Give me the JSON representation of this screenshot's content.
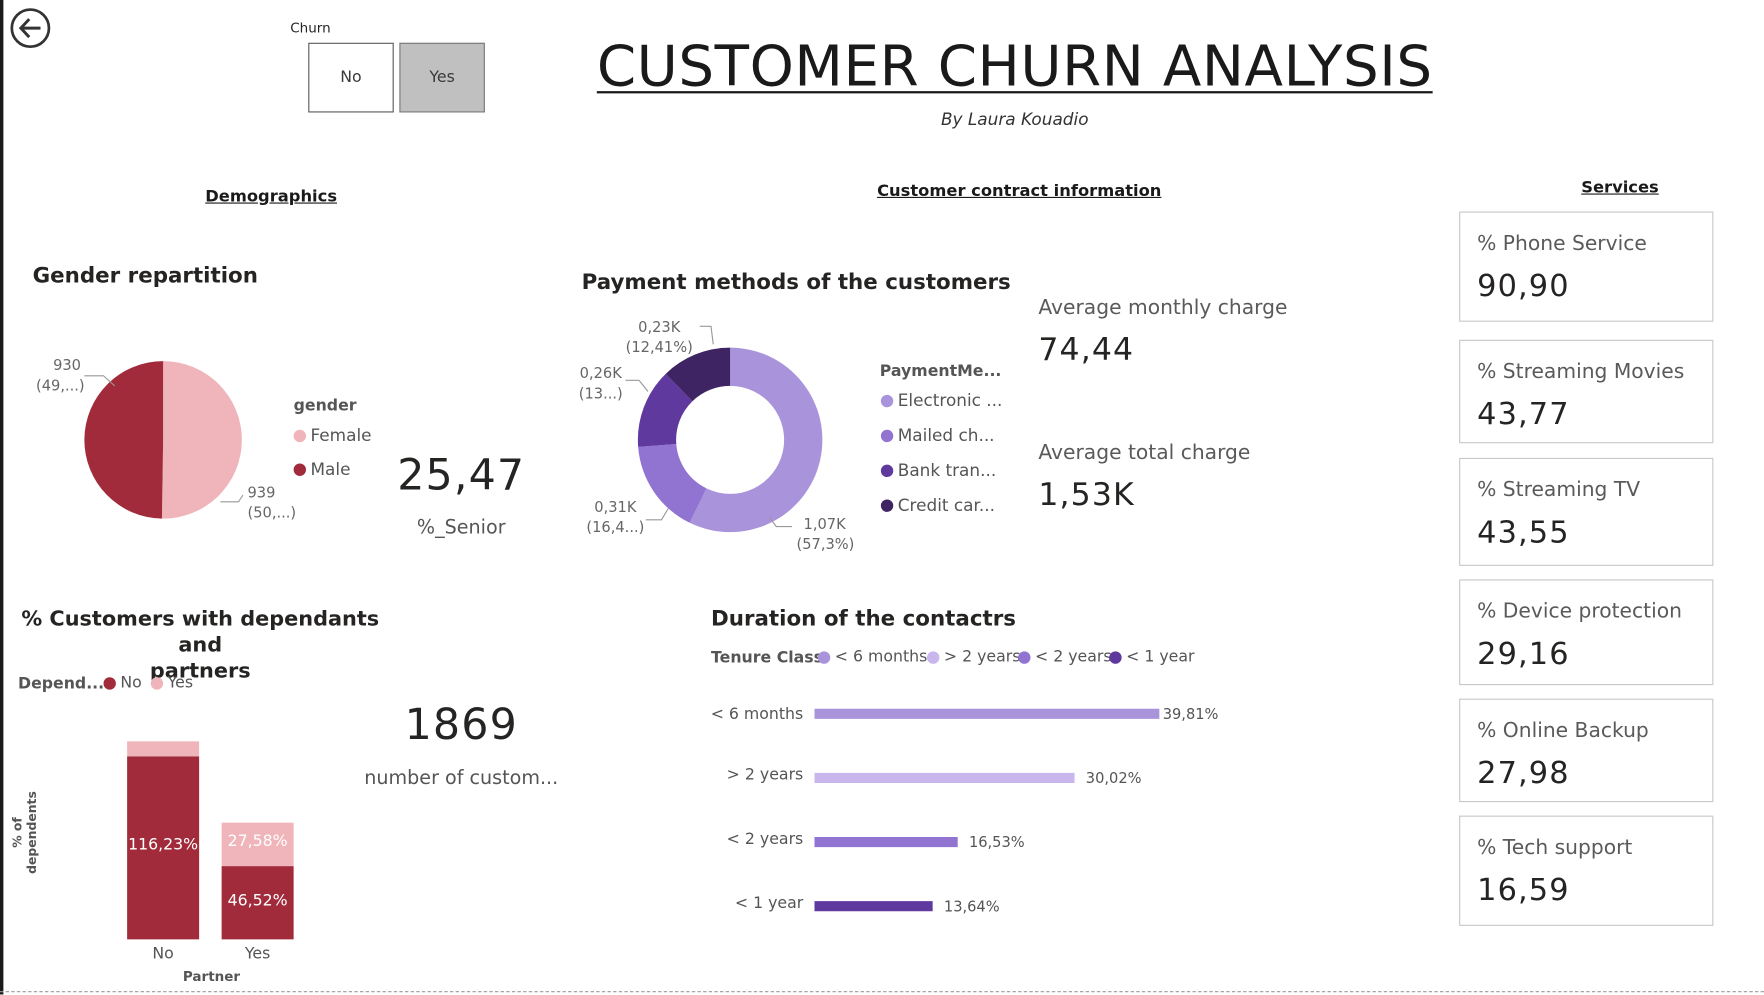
{
  "header": {
    "title": "CUSTOMER CHURN ANALYSIS",
    "subtitle": "By Laura Kouadio"
  },
  "back_button": {
    "icon": "arrow-left-circle-icon"
  },
  "churn_slicer": {
    "title": "Churn",
    "options": [
      "No",
      "Yes"
    ],
    "selected": "Yes"
  },
  "sections": {
    "demographics": "Demographics",
    "contract": "Customer contract information",
    "services": "Services"
  },
  "gender_chart": {
    "title": "Gender repartition",
    "legend_title": "gender",
    "legend": [
      "Female",
      "Male"
    ],
    "label_male": [
      "930",
      "(49,...)"
    ],
    "label_female": [
      "939",
      "(50,...)"
    ]
  },
  "senior_kpi": {
    "value": "25,47",
    "label": "%_Senior"
  },
  "payment_chart": {
    "title": "Payment methods of the customers",
    "legend_title": "PaymentMe...",
    "legend": [
      "Electronic ...",
      "Mailed ch...",
      "Bank tran...",
      "Credit car..."
    ],
    "labels": {
      "electronic": [
        "1,07K",
        "(57,3%)"
      ],
      "mailed": [
        "0,31K",
        "(16,4...)"
      ],
      "bank": [
        "0,26K",
        "(13...)"
      ],
      "credit": [
        "0,23K",
        "(12,41%)"
      ]
    }
  },
  "monthly_charge": {
    "label": "Average monthly charge",
    "value": "74,44"
  },
  "total_charge": {
    "label": "Average total charge",
    "value": "1,53K"
  },
  "services_cards": [
    {
      "label": "% Phone Service",
      "value": "90,90"
    },
    {
      "label": "% Streaming Movies",
      "value": "43,77"
    },
    {
      "label": "% Streaming TV",
      "value": "43,55"
    },
    {
      "label": "% Device protection",
      "value": "29,16"
    },
    {
      "label": "% Online Backup",
      "value": "27,98"
    },
    {
      "label": "% Tech support",
      "value": "16,59"
    }
  ],
  "dependants_chart": {
    "title_line1": "% Customers with dependants and",
    "title_line2": "partners",
    "legend_title": "Depend...",
    "legend": [
      "No",
      "Yes"
    ],
    "xlabel": "Partner",
    "ylabel": "% of dependents",
    "bar_labels": {
      "no_no": "116,23%",
      "yes_no": "46,52%",
      "yes_yes": "27,58%"
    },
    "categories": [
      "No",
      "Yes"
    ]
  },
  "customers_kpi": {
    "value": "1869",
    "label": "number of custom..."
  },
  "duration_chart": {
    "title": "Duration of the contactrs",
    "legend_title": "Tenure Class",
    "legend": [
      "< 6 months",
      "> 2 years",
      "< 2 years",
      "< 1 year"
    ],
    "categories": [
      "< 6 months",
      "> 2 years",
      "< 2 years",
      "< 1 year"
    ],
    "value_labels": [
      "39,81%",
      "30,02%",
      "16,53%",
      "13,64%"
    ]
  },
  "colors": {
    "male": "#a12b3b",
    "female": "#f0b5ba",
    "electronic": "#a994dc",
    "mailed": "#9173d2",
    "bank": "#60399f",
    "credit": "#3f2463",
    "tenure_lt6": "#a994dc",
    "tenure_gt2": "#c8b6ec",
    "tenure_lt2": "#9173d2",
    "tenure_lt1": "#60399f"
  },
  "chart_data": [
    {
      "type": "pie",
      "title": "Gender repartition",
      "categories": [
        "Female",
        "Male"
      ],
      "values": [
        939,
        930
      ],
      "percent_labels": [
        "(50,...)",
        "(49,...)"
      ]
    },
    {
      "type": "pie",
      "title": "Payment methods of the customers",
      "categories": [
        "Electronic ...",
        "Mailed ch...",
        "Bank tran...",
        "Credit car..."
      ],
      "values": [
        1.07,
        0.31,
        0.26,
        0.23
      ],
      "percents": [
        57.3,
        16.4,
        13.9,
        12.41
      ]
    },
    {
      "type": "bar",
      "title": "% Customers with dependants and partners",
      "xlabel": "Partner",
      "ylabel": "% of dependents",
      "categories": [
        "No",
        "Yes"
      ],
      "series": [
        {
          "name": "No",
          "values": [
            116.23,
            46.52
          ]
        },
        {
          "name": "Yes",
          "values": [
            9.5,
            27.58
          ]
        }
      ]
    },
    {
      "type": "bar",
      "orientation": "horizontal",
      "title": "Duration of the contactrs",
      "categories": [
        "< 6 months",
        "> 2 years",
        "< 2 years",
        "< 1 year"
      ],
      "values": [
        39.81,
        30.02,
        16.53,
        13.64
      ],
      "unit": "%"
    }
  ]
}
